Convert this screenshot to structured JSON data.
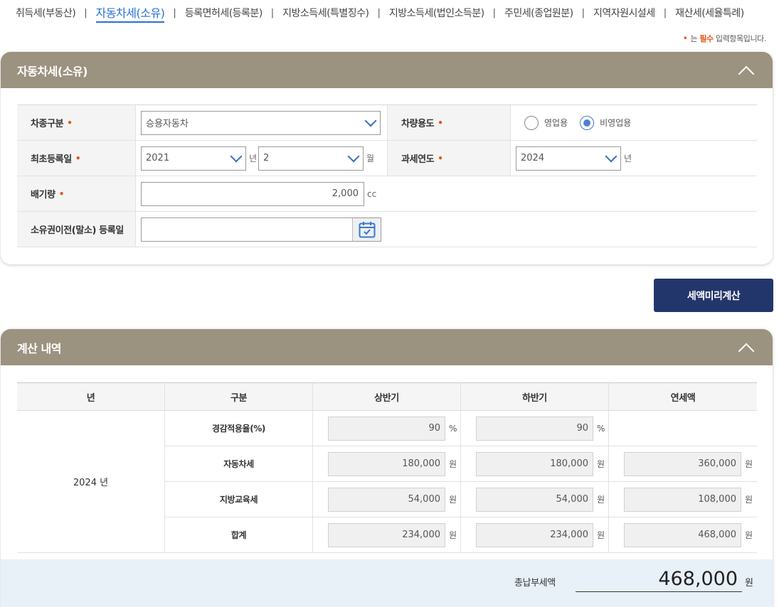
{
  "tabs": [
    {
      "label": "취득세(부동산)",
      "active": false
    },
    {
      "label": "자동차세(소유)",
      "active": true
    },
    {
      "label": "등록면허세(등록분)",
      "active": false
    },
    {
      "label": "지방소득세(특별징수)",
      "active": false
    },
    {
      "label": "지방소득세(법인소득분)",
      "active": false
    },
    {
      "label": "주민세(종업원분)",
      "active": false
    },
    {
      "label": "지역자원시설세",
      "active": false
    },
    {
      "label": "재산세(세율특례)",
      "active": false
    }
  ],
  "tab_separator": "|",
  "required_note": {
    "bullet": "•",
    "prefix": "는 ",
    "highlight": "필수",
    "suffix": " 입력항목입니다."
  },
  "form_panel": {
    "title": "자동차세(소유)",
    "vehicle_type": {
      "label": "차종구분",
      "value": "승용자동차"
    },
    "vehicle_use": {
      "label": "차량용도",
      "options": [
        "영업용",
        "비영업용"
      ],
      "selected": "비영업용"
    },
    "first_registration": {
      "label": "최초등록일",
      "year": "2021",
      "year_unit": "년",
      "month": "2",
      "month_unit": "월"
    },
    "tax_year": {
      "label": "과세연도",
      "value": "2024",
      "unit": "년"
    },
    "displacement": {
      "label": "배기량",
      "value": "2,000",
      "unit": "cc"
    },
    "transfer_date": {
      "label": "소유권이전(말소) 등록일",
      "value": ""
    },
    "required_mark": "•"
  },
  "calc_button": "세액미리계산",
  "result_panel": {
    "title": "계산 내역",
    "headers": [
      "년",
      "구분",
      "상반기",
      "하반기",
      "연세액"
    ],
    "year": "2024 년",
    "rows": [
      {
        "label": "경감적용율(%)",
        "first": "90",
        "second": "90",
        "annual": null,
        "unit": "%"
      },
      {
        "label": "자동차세",
        "first": "180,000",
        "second": "180,000",
        "annual": "360,000",
        "unit": "원"
      },
      {
        "label": "지방교육세",
        "first": "54,000",
        "second": "54,000",
        "annual": "108,000",
        "unit": "원"
      },
      {
        "label": "합계",
        "first": "234,000",
        "second": "234,000",
        "annual": "468,000",
        "unit": "원"
      }
    ],
    "total_label": "총납부세액",
    "total_value": "468,000",
    "total_unit": "원"
  },
  "colors": {
    "header_bg": "#9c9280",
    "accent_blue": "#2a6fd6",
    "button_bg": "#23366b",
    "required": "#e0561b",
    "total_bg": "#e8f0f8"
  }
}
